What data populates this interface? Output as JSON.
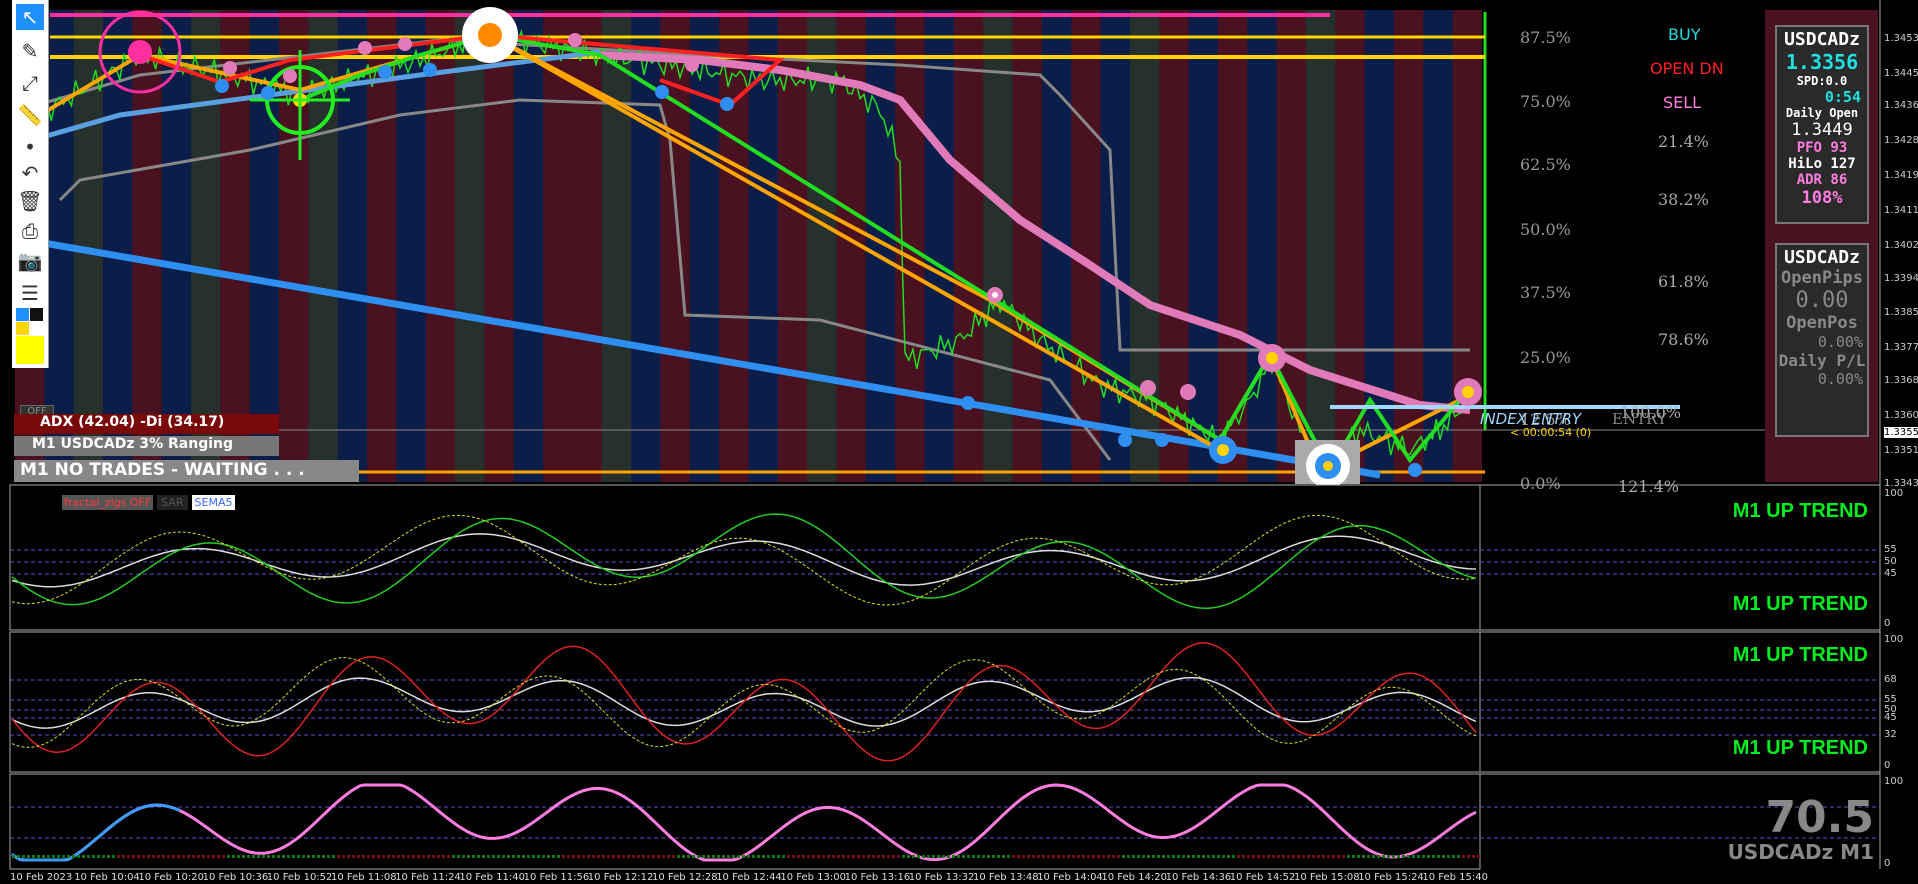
{
  "toolbar": {
    "tools": [
      {
        "name": "cursor-tool",
        "glyph": "↖",
        "active": true
      },
      {
        "name": "pencil-tool",
        "glyph": "✎"
      },
      {
        "name": "line-tool",
        "glyph": "⤢"
      },
      {
        "name": "ruler-tool",
        "glyph": "📏"
      },
      {
        "name": "dot-tool",
        "glyph": "•"
      },
      {
        "name": "undo-tool",
        "glyph": "↶"
      },
      {
        "name": "trash-tool",
        "glyph": "🗑"
      },
      {
        "name": "printer-tool",
        "glyph": "⎙"
      },
      {
        "name": "camera-tool",
        "glyph": "📷"
      },
      {
        "name": "notes-tool",
        "glyph": "☰"
      }
    ],
    "color_swatches": [
      "#1e90ff",
      "#111111",
      "#ffd700",
      "#ffff00"
    ]
  },
  "fib_levels": [
    "87.5%",
    "75.0%",
    "62.5%",
    "50.0%",
    "37.5%",
    "25.0%",
    "12.5%",
    "0.0%"
  ],
  "fib_retrace": [
    "21.4%",
    "38.2%",
    "61.8%",
    "78.6%",
    "100.0%",
    "121.4%"
  ],
  "signals": {
    "buy": "BUY",
    "open": "OPEN DN",
    "sell": "SELL"
  },
  "index_entry": "INDEX ENTRY",
  "entry_word": "ENTRY",
  "countdown": "< 00:00:54 (0)",
  "symbol_box": {
    "symbol": "USDCADz",
    "price": "1.3356",
    "spread": "SPD:0.0",
    "timer": "0:54",
    "daily_open_label": "Daily Open",
    "daily_open": "1.3449",
    "pfo": "PFO  93",
    "hilo": "HiLo 127",
    "adr": "ADR  86",
    "pct": "108%"
  },
  "trade_box": {
    "symbol": "USDCADz",
    "open_pips_label": "OpenPips",
    "open_pips": "0.00",
    "open_pos_label": "OpenPos",
    "open_pos": "0.00%",
    "daily_pl_label": "Daily P/L",
    "daily_pl": "0.00%"
  },
  "status": {
    "off_button": "OFF",
    "adx": "ADX (42.04)  -Di (34.17)",
    "ranging": "M1 USDCADz 3% Ranging",
    "trades": "M1  NO TRADES - WAITING . . ."
  },
  "price_axis": [
    "1.34535",
    "1.34450",
    "1.34365",
    "1.34280",
    "1.34195",
    "1.34110",
    "1.34025",
    "1.33940",
    "1.33855",
    "1.33770",
    "1.33685",
    "1.33600",
    "1.33557",
    "1.33515",
    "1.33430"
  ],
  "subpanel1": {
    "legend": [
      {
        "label": "fractal_zigs",
        "state": "fractal_zigs OFF",
        "color": "#ff3b3b"
      },
      {
        "label": "SAR",
        "color": "#555555"
      },
      {
        "label": "SEMA5",
        "color": "#3b6bff"
      }
    ],
    "trend_top": "M1 UP TREND",
    "trend_bottom": "M1 UP TREND",
    "axis": [
      "100",
      "55",
      "50",
      "45",
      "0"
    ]
  },
  "subpanel2": {
    "trend_top": "M1 UP TREND",
    "trend_bottom": "M1 UP TREND",
    "axis": [
      "100",
      "68",
      "55",
      "50",
      "45",
      "32",
      "0"
    ]
  },
  "subpanel3": {
    "big_value": "70.5",
    "symbol_tf": "USDCADz M1",
    "axis": [
      "100",
      "0"
    ]
  },
  "time_axis": [
    "10 Feb 2023",
    "10 Feb 10:04",
    "10 Feb 10:20",
    "10 Feb 10:36",
    "10 Feb 10:52",
    "10 Feb 11:08",
    "10 Feb 11:24",
    "10 Feb 11:40",
    "10 Feb 11:56",
    "10 Feb 12:12",
    "10 Feb 12:28",
    "10 Feb 12:44",
    "10 Feb 13:00",
    "10 Feb 13:16",
    "10 Feb 13:32",
    "10 Feb 13:48",
    "10 Feb 14:04",
    "10 Feb 14:20",
    "10 Feb 14:36",
    "10 Feb 14:52",
    "10 Feb 15:08",
    "10 Feb 15:24",
    "10 Feb 15:40"
  ],
  "colors": {
    "bear_band": "#4a1120",
    "bull_band": "#0b1e4a",
    "neutral_band": "#26302c",
    "ma_pink": "#e07ab8",
    "trend_blue": "#2e8ff0",
    "zigzag_orange": "#ffa500",
    "level_yellow": "#ffd400",
    "magenta": "#ff2fa0",
    "green": "#22dd22",
    "red": "#ff2020"
  }
}
